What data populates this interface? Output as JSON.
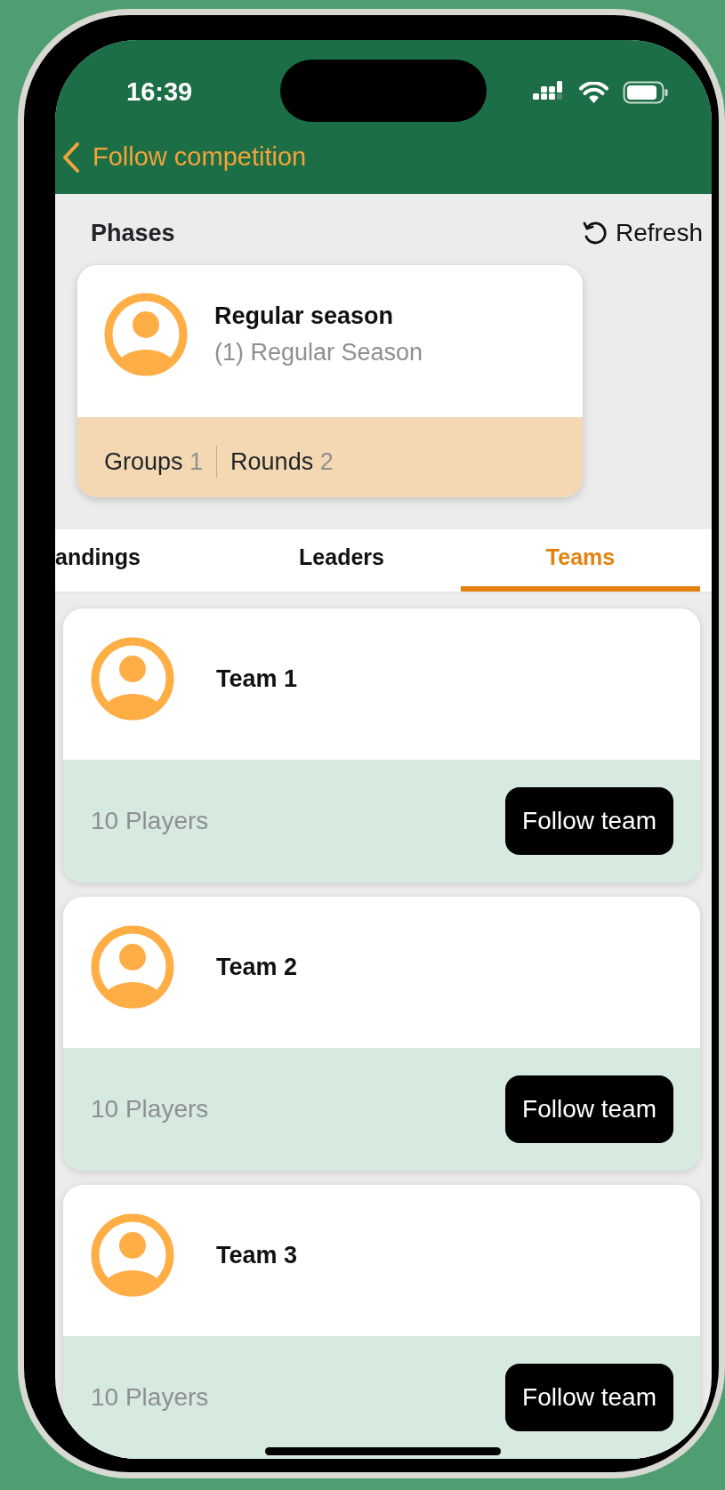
{
  "status_bar": {
    "time": "16:39"
  },
  "nav": {
    "back_label": "Follow competition"
  },
  "phases": {
    "title": "Phases",
    "refresh_label": "Refresh",
    "items": [
      {
        "name": "Regular season",
        "subtitle": "(1) Regular Season",
        "stats": [
          {
            "label": "Groups",
            "value": "1"
          },
          {
            "label": "Rounds",
            "value": "2"
          }
        ]
      }
    ]
  },
  "tabs": [
    {
      "label": "andings",
      "selected": false
    },
    {
      "label": "Leaders",
      "selected": false
    },
    {
      "label": "Teams",
      "selected": true
    }
  ],
  "teams": [
    {
      "name": "Team 1",
      "players": "10 Players",
      "button": "Follow team"
    },
    {
      "name": "Team 2",
      "players": "10 Players",
      "button": "Follow team"
    },
    {
      "name": "Team 3",
      "players": "10 Players",
      "button": "Follow team"
    }
  ]
}
